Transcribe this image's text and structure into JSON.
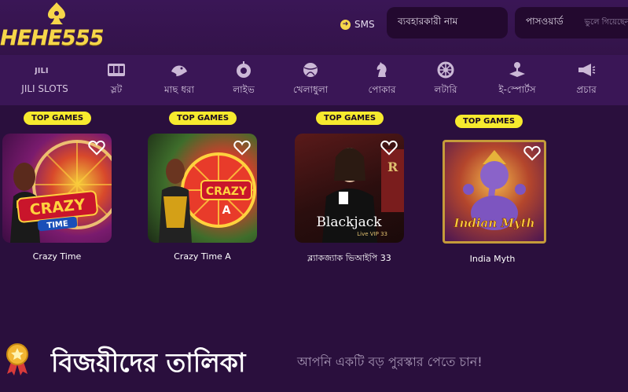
{
  "brand": {
    "name": "HEHE555"
  },
  "auth": {
    "sms_label": "SMS",
    "username_placeholder": "ব্যবহারকারী নাম",
    "password_placeholder": "পাসওয়ার্ড",
    "forgot_label": "ভুলে গিয়েছেন"
  },
  "nav": [
    {
      "label": "JILI SLOTS",
      "icon": "jili-icon"
    },
    {
      "label": "স্লট",
      "icon": "slot-machine-icon"
    },
    {
      "label": "মাছ ধরা",
      "icon": "fish-icon"
    },
    {
      "label": "লাইভ",
      "icon": "roulette-icon"
    },
    {
      "label": "খেলাধুলা",
      "icon": "ball-icon"
    },
    {
      "label": "পোকার",
      "icon": "chess-knight-icon"
    },
    {
      "label": "লটারি",
      "icon": "lottery-wheel-icon"
    },
    {
      "label": "ই-স্পোর্টস",
      "icon": "joystick-icon"
    },
    {
      "label": "প্রচার",
      "icon": "megaphone-icon"
    }
  ],
  "games": [
    {
      "badge": "TOP GAMES",
      "name": "Crazy Time",
      "art_text": "CRAZY"
    },
    {
      "badge": "TOP GAMES",
      "name": "Crazy Time A",
      "art_text": "CRAZY"
    },
    {
      "badge": "TOP GAMES",
      "name": "ব্ল্যাকজ্যাক ভিআইপি 33",
      "art_text": "Blackjack"
    },
    {
      "badge": "TOP GAMES",
      "name": "India Myth",
      "art_text": "Indian Myth"
    }
  ],
  "winners": {
    "title": "বিজয়ীদের তালিকা",
    "subtitle": "আপনি একটি বড় পুরস্কার পেতে চান!"
  },
  "colors": {
    "background": "#2a0f3d",
    "header": "#3a1656",
    "accent_gold": "#f6d64a",
    "badge_yellow": "#f7ea2e"
  }
}
